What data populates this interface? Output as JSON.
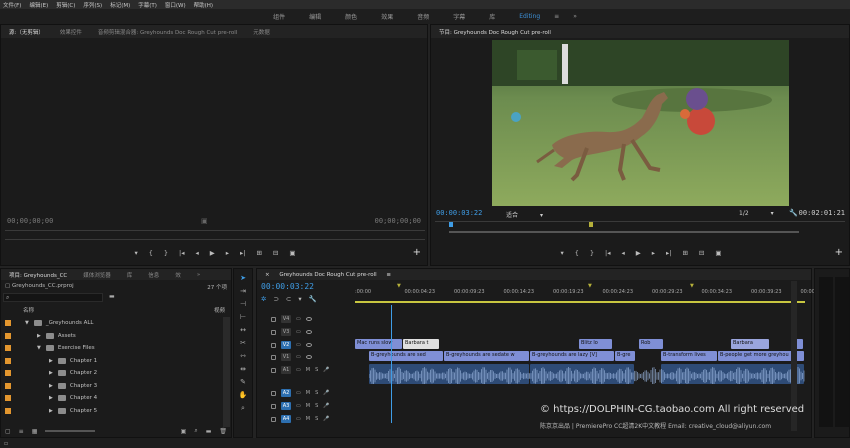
{
  "menu": [
    "文件(F)",
    "编辑(E)",
    "剪辑(C)",
    "序列(S)",
    "标记(M)",
    "字幕(T)",
    "窗口(W)",
    "帮助(H)"
  ],
  "workspaces": [
    "组件",
    "编辑",
    "颜色",
    "效果",
    "音频",
    "字幕",
    "库",
    "Editing",
    "≡",
    "»"
  ],
  "source": {
    "tabs": [
      "源:（无剪辑）",
      "效果控件",
      "音频剪辑混合器: Greyhounds Doc Rough Cut pre-roll",
      "元数据"
    ],
    "timecode_left": "00;00;00;00",
    "timecode_right": "00;00;00;00"
  },
  "program": {
    "tab": "节目: Greyhounds Doc Rough Cut pre-roll",
    "timecode": "00:00:03:22",
    "fit": "适合",
    "resolution": "1/2",
    "duration": "00:02:01:21"
  },
  "project": {
    "tabs": [
      "项目: Greyhounds_CC",
      "媒体浏览器",
      "库",
      "信息",
      "效"
    ],
    "file": "Greyhounds_CC.prproj",
    "count": "27 个项",
    "col_name": "名称",
    "col_right": "视频",
    "items": [
      {
        "label": "_Greyhounds ALL",
        "indent": 1,
        "expanded": true
      },
      {
        "label": "Assets",
        "indent": 2,
        "expanded": false
      },
      {
        "label": "Exercise Files",
        "indent": 2,
        "expanded": true
      },
      {
        "label": "Chapter 1",
        "indent": 3,
        "expanded": false
      },
      {
        "label": "Chapter 2",
        "indent": 3,
        "expanded": false
      },
      {
        "label": "Chapter 3",
        "indent": 3,
        "expanded": false
      },
      {
        "label": "Chapter 4",
        "indent": 3,
        "expanded": false
      },
      {
        "label": "Chapter 5",
        "indent": 3,
        "expanded": false
      }
    ]
  },
  "timeline": {
    "tab": "Greyhounds Doc Rough Cut pre-roll",
    "timecode": "00:00:03:22",
    "ruler": [
      ":00:00",
      "00:00:04:23",
      "00:00:09:23",
      "00:00:14:23",
      "00:00:19:23",
      "00:00:24:23",
      "00:00:29:23",
      "00:00:34:23",
      "00:00:39:23",
      "00:00:44:22"
    ],
    "tracks": [
      {
        "name": "V4",
        "type": "video"
      },
      {
        "name": "V3",
        "type": "video"
      },
      {
        "name": "V2",
        "type": "video"
      },
      {
        "name": "V1",
        "type": "video"
      },
      {
        "name": "A1",
        "type": "audio"
      },
      {
        "name": "A2",
        "type": "audio"
      },
      {
        "name": "A3",
        "type": "audio"
      },
      {
        "name": "A4",
        "type": "audio"
      }
    ],
    "v2_clips": [
      "Mac runs slow",
      "Barbara t",
      "Blitz lo",
      "Rob",
      "Barbara"
    ],
    "v1_clips": [
      "B-greyhounds are sed",
      "B-greyhounds are sedate w",
      "B-greyhounds are lazy [V]",
      "B-gre",
      "B-transform lives",
      "B-people get more greyhou"
    ]
  },
  "watermark": {
    "line1": "© https://DOLPHIN-CG.taobao.com  All right reserved",
    "line2": "陈京京出品 | PremierePro CC超清2K中文教程 Email: creative_cloud@aliyun.com"
  }
}
